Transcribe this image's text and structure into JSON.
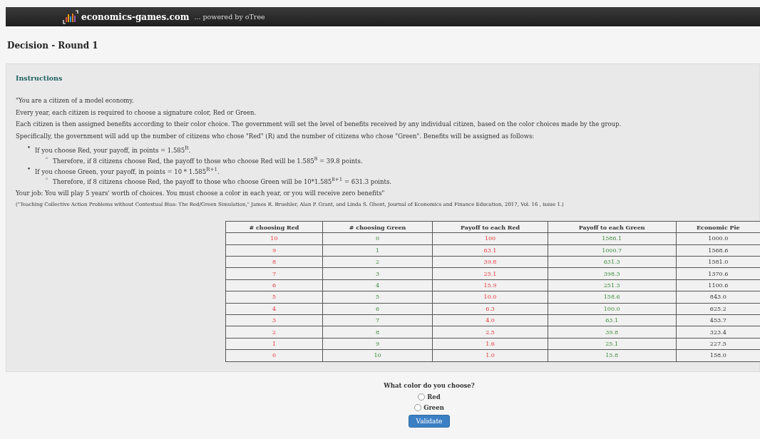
{
  "navbar": {
    "brand": "economics-games.com",
    "tagline": "... powered by oTree"
  },
  "page_title": "Decision - Round 1",
  "instructions": {
    "heading": "Instructions",
    "paragraphs": [
      "\"You are a citizen of a model economy.",
      "Every year, each citizen is required to choose a signature color, Red or Green.",
      "Each citizen is then assigned benefits according to their color choice. The government will set the level of benefits received by any individual citizen, based on the color choices made by the group.",
      "Specifically, the government will add up the number of citizens who chose \"Red\" (R) and the number of citizens who chose \"Green\". Benefits will be assigned as follows:"
    ],
    "bullets": [
      {
        "marker": "•",
        "text": "If you choose Red, your payoff, in points = 1.585$^{R}$.",
        "children": [
          {
            "marker": "◦",
            "text": "Therefore, if 8 citizens choose Red, the payoff to those who choose Red will be 1.585$^{8}$ = 39.8 points."
          }
        ]
      },
      {
        "marker": "•",
        "text": "If you choose Green, your payoff, in points = 10 * 1.585$^{R+1}$.",
        "children": [
          {
            "marker": "◦",
            "text": "Therefore, if 8 citizens choose Red, the payoff to those who choose Green will be 10*1.585$^{8+1}$ = 631.3 points."
          }
        ]
      }
    ],
    "closing": "Your job: You will play 5 years' worth of choices. You must choose a color in each year, or you will receive zero benefits\"",
    "citation": "(\"Teaching Collective Action Problems without Contextual Bias: The Red/Green Simulation,\" James R. Bruehler, Alan P. Grant, and Linda S. Ghent, Journal of Economics and Finance Education, 2017, Vol. 16 , issue 1.)"
  },
  "table": {
    "columns": [
      {
        "label": "# choosing Red",
        "kind": "red"
      },
      {
        "label": "# choosing Green",
        "kind": "green"
      },
      {
        "label": "Payoff to each Red",
        "kind": "red"
      },
      {
        "label": "Payoff to each Green",
        "kind": "green"
      },
      {
        "label": "Economic Pie",
        "kind": "total"
      }
    ],
    "rows": [
      [
        "10",
        "0",
        "100",
        "1586.1",
        "1000.0"
      ],
      [
        "9",
        "1",
        "63.1",
        "1000.7",
        "1568.6"
      ],
      [
        "8",
        "2",
        "39.8",
        "631.3",
        "1581.0"
      ],
      [
        "7",
        "3",
        "25.1",
        "398.3",
        "1370.6"
      ],
      [
        "6",
        "4",
        "15.9",
        "251.3",
        "1100.6"
      ],
      [
        "5",
        "5",
        "10.0",
        "158.6",
        "843.0"
      ],
      [
        "4",
        "6",
        "6.3",
        "100.0",
        "625.2"
      ],
      [
        "3",
        "7",
        "4.0",
        "63.1",
        "453.7"
      ],
      [
        "2",
        "8",
        "2.5",
        "39.8",
        "323.4"
      ],
      [
        "1",
        "9",
        "1.6",
        "25.1",
        "227.5"
      ],
      [
        "0",
        "10",
        "1.0",
        "15.8",
        "158.0"
      ]
    ]
  },
  "question": {
    "label": "What color do you choose?",
    "options": [
      {
        "label": "Red",
        "selected": false
      },
      {
        "label": "Green",
        "selected": false
      }
    ]
  },
  "submit": "Validate"
}
